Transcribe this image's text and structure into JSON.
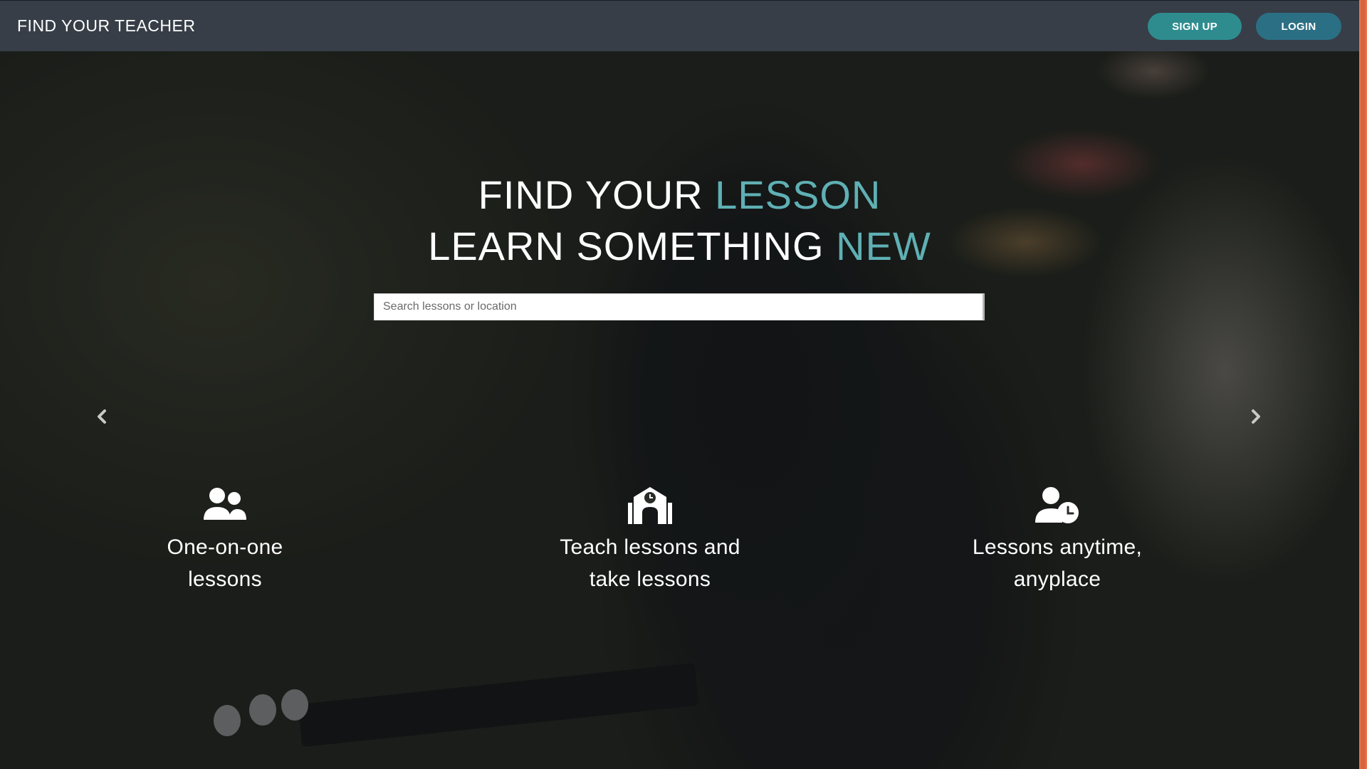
{
  "navbar": {
    "brand": "FIND YOUR TEACHER",
    "signup_label": "SIGN UP",
    "login_label": "LOGIN"
  },
  "hero": {
    "line1_prefix": "FIND YOUR ",
    "line1_accent": "LESSON",
    "line2_prefix": "LEARN SOMETHING ",
    "line2_accent": "NEW",
    "search": {
      "placeholder": "Search lessons or location",
      "value": ""
    },
    "carousel": {
      "prev_icon": "chevron-left-icon",
      "next_icon": "chevron-right-icon"
    }
  },
  "features": [
    {
      "icon": "users-icon",
      "label": "One-on-one lessons"
    },
    {
      "icon": "school-clock-icon",
      "label": "Teach lessons and take lessons"
    },
    {
      "icon": "user-clock-icon",
      "label": "Lessons anytime, anyplace"
    }
  ],
  "colors": {
    "navbar_bg": "#373e48",
    "accent": "#5fb0b4",
    "signup_bg": "#2e8c8f",
    "login_bg": "#2b6f84",
    "scrollbar": "#e8774f"
  }
}
